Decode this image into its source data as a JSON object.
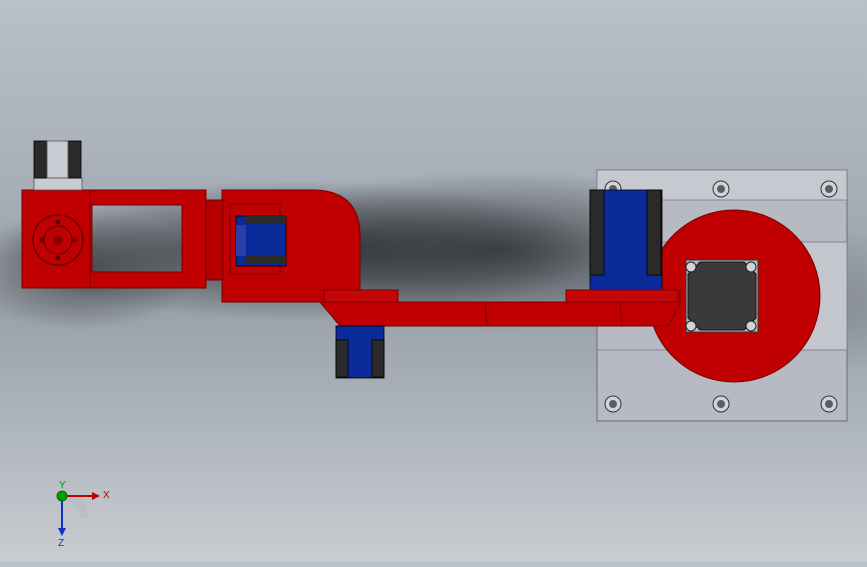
{
  "viewport": {
    "model": {
      "colors": {
        "arm": "#c00000",
        "arm_dark": "#8a0000",
        "joint": "#0a2a9a",
        "bushing": "#2a2a2a",
        "base_plate": "#b7bac3",
        "base_edge": "#6b6e75"
      }
    },
    "triad": {
      "x_label": "X",
      "y_label": "Y",
      "z_label": "Z",
      "colors": {
        "x": "#c00000",
        "y": "#00a000",
        "z": "#1030c0"
      }
    }
  }
}
